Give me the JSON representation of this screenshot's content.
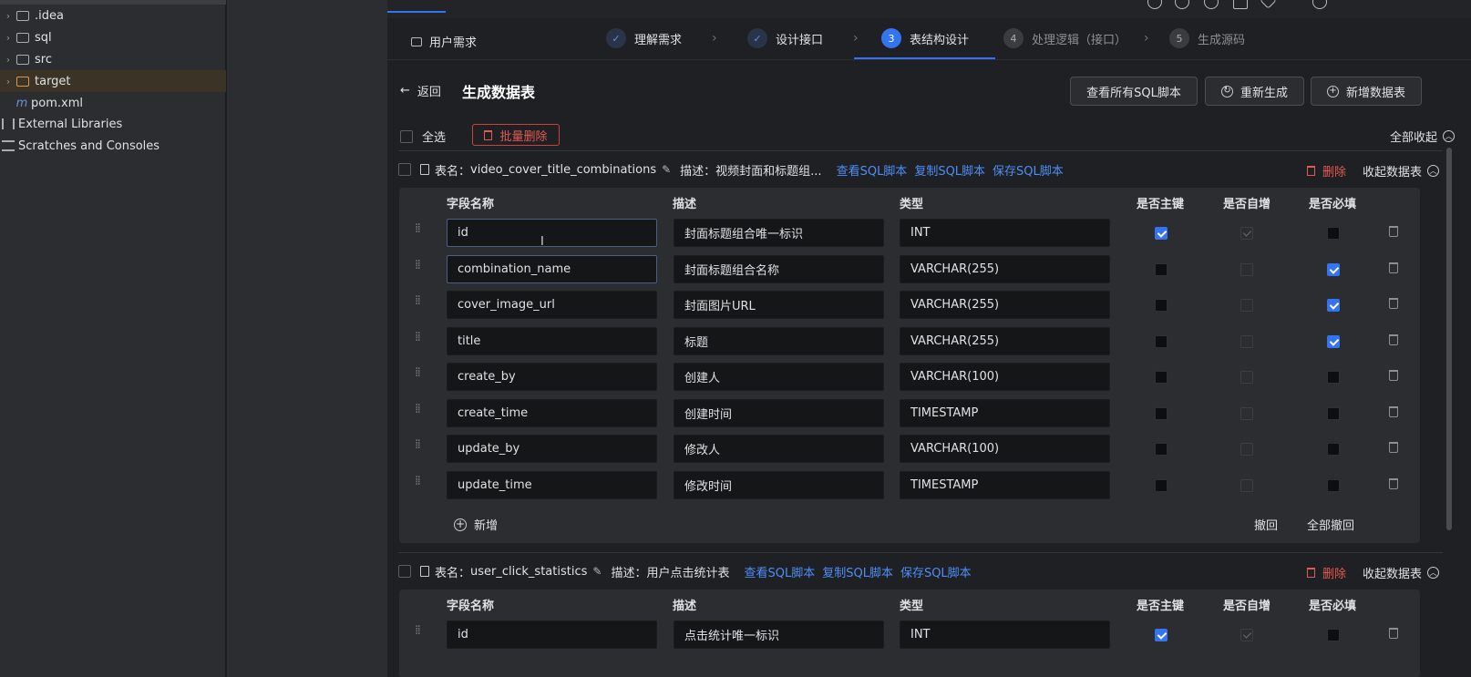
{
  "tree": {
    "items": [
      {
        "label": ".idea",
        "kind": "folder"
      },
      {
        "label": "sql",
        "kind": "folder"
      },
      {
        "label": "src",
        "kind": "folder"
      },
      {
        "label": "target",
        "kind": "folder-orange"
      },
      {
        "label": "pom.xml",
        "kind": "maven"
      },
      {
        "label": "External Libraries",
        "kind": "library"
      },
      {
        "label": "Scratches and Consoles",
        "kind": "scratch"
      }
    ]
  },
  "stepper": {
    "requirement": "用户需求",
    "steps": [
      {
        "num": "✓",
        "label": "理解需求",
        "state": "done"
      },
      {
        "num": "✓",
        "label": "设计接口",
        "state": "done"
      },
      {
        "num": "3",
        "label": "表结构设计",
        "state": "active"
      },
      {
        "num": "4",
        "label": "处理逻辑（接口）",
        "state": "todo"
      },
      {
        "num": "5",
        "label": "生成源码",
        "state": "todo"
      }
    ]
  },
  "header": {
    "back": "返回",
    "title": "生成数据表",
    "btn_view_sql": "查看所有SQL脚本",
    "btn_regen": "重新生成",
    "btn_add_table": "新增数据表"
  },
  "toolbar": {
    "select_all": "全选",
    "batch_delete": "批量删除",
    "collapse_all": "全部收起"
  },
  "columns": {
    "field": "字段名称",
    "desc": "描述",
    "type": "类型",
    "pk": "是否主键",
    "auto": "是否自增",
    "required": "是否必填"
  },
  "common": {
    "table_label": "表名：",
    "desc_label": "描述：",
    "view_sql": "查看SQL脚本",
    "copy_sql": "复制SQL脚本",
    "save_sql": "保存SQL脚本",
    "delete": "删除",
    "collapse": "收起数据表",
    "add": "新增",
    "undo": "撤回",
    "undo_all": "全部撤回"
  },
  "tables": [
    {
      "name": "video_cover_title_combinations",
      "description": "视频封面和标题组...",
      "rows": [
        {
          "field": "id",
          "desc": "封面标题组合唯一标识",
          "type": "INT",
          "pk": true,
          "auto": true,
          "required": false
        },
        {
          "field": "combination_name",
          "desc": "封面标题组合名称",
          "type": "VARCHAR(255)",
          "pk": false,
          "auto": false,
          "required": true
        },
        {
          "field": "cover_image_url",
          "desc": "封面图片URL",
          "type": "VARCHAR(255)",
          "pk": false,
          "auto": false,
          "required": true
        },
        {
          "field": "title",
          "desc": "标题",
          "type": "VARCHAR(255)",
          "pk": false,
          "auto": false,
          "required": true
        },
        {
          "field": "create_by",
          "desc": "创建人",
          "type": "VARCHAR(100)",
          "pk": false,
          "auto": false,
          "required": false
        },
        {
          "field": "create_time",
          "desc": "创建时间",
          "type": "TIMESTAMP",
          "pk": false,
          "auto": false,
          "required": false
        },
        {
          "field": "update_by",
          "desc": "修改人",
          "type": "VARCHAR(100)",
          "pk": false,
          "auto": false,
          "required": false
        },
        {
          "field": "update_time",
          "desc": "修改时间",
          "type": "TIMESTAMP",
          "pk": false,
          "auto": false,
          "required": false
        }
      ]
    },
    {
      "name": "user_click_statistics",
      "description": "用户点击统计表",
      "rows": [
        {
          "field": "id",
          "desc": "点击统计唯一标识",
          "type": "INT",
          "pk": true,
          "auto": true,
          "required": false
        }
      ]
    }
  ]
}
